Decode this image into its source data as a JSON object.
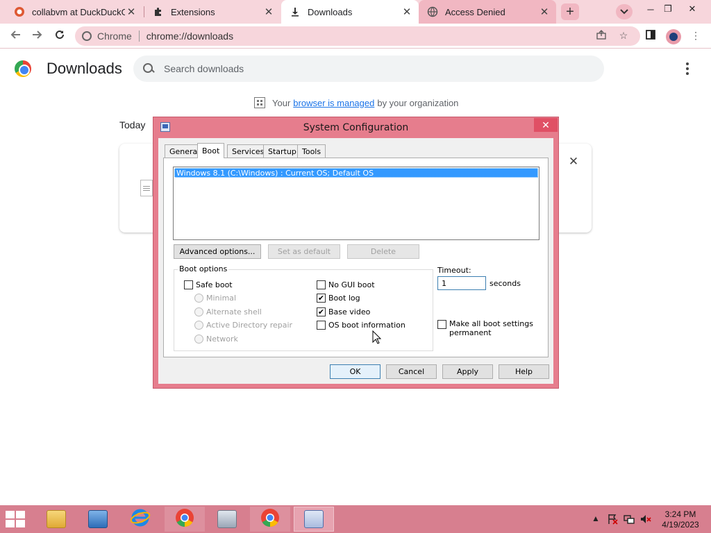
{
  "browser": {
    "tabs": [
      {
        "label": "collabvm at DuckDuckGo",
        "icon": "duckduckgo-icon"
      },
      {
        "label": "Extensions",
        "icon": "puzzle-icon"
      },
      {
        "label": "Downloads",
        "icon": "download-icon"
      },
      {
        "label": "Access Denied",
        "icon": "globe-icon"
      }
    ],
    "omnibox": {
      "site_label": "Chrome",
      "url": "chrome://downloads"
    }
  },
  "downloads_page": {
    "title": "Downloads",
    "search_placeholder": "Search downloads",
    "managed_prefix": "Your",
    "managed_link": "browser is managed",
    "managed_suffix": "by your organization",
    "section_label": "Today"
  },
  "dialog": {
    "title": "System Configuration",
    "tabs": [
      "General",
      "Boot",
      "Services",
      "Startup",
      "Tools"
    ],
    "selected_tab": "Boot",
    "os_entries": [
      "Windows 8.1 (C:\\Windows) : Current OS; Default OS"
    ],
    "buttons": {
      "advanced": "Advanced options...",
      "set_default": "Set as default",
      "delete": "Delete",
      "ok": "OK",
      "cancel": "Cancel",
      "apply": "Apply",
      "help": "Help"
    },
    "boot_options": {
      "legend": "Boot options",
      "safe_boot": {
        "label": "Safe boot",
        "checked": false
      },
      "safe_modes": [
        "Minimal",
        "Alternate shell",
        "Active Directory repair",
        "Network"
      ],
      "no_gui_boot": {
        "label": "No GUI boot",
        "checked": false
      },
      "boot_log": {
        "label": "Boot log",
        "checked": true
      },
      "base_video": {
        "label": "Base video",
        "checked": true
      },
      "os_boot_info": {
        "label": "OS boot information",
        "checked": false
      }
    },
    "timeout": {
      "label": "Timeout:",
      "value": "1",
      "unit": "seconds"
    },
    "make_permanent": {
      "label": "Make all boot settings permanent",
      "checked": false
    }
  },
  "taskbar": {
    "clock_time": "3:24 PM",
    "clock_date": "4/19/2023"
  },
  "colors": {
    "accent_pink": "#f7d6dc",
    "dialog_frame": "#e67d8d",
    "selection_blue": "#3399ff",
    "link_blue": "#1a73e8",
    "taskbar": "#d77f8f"
  }
}
